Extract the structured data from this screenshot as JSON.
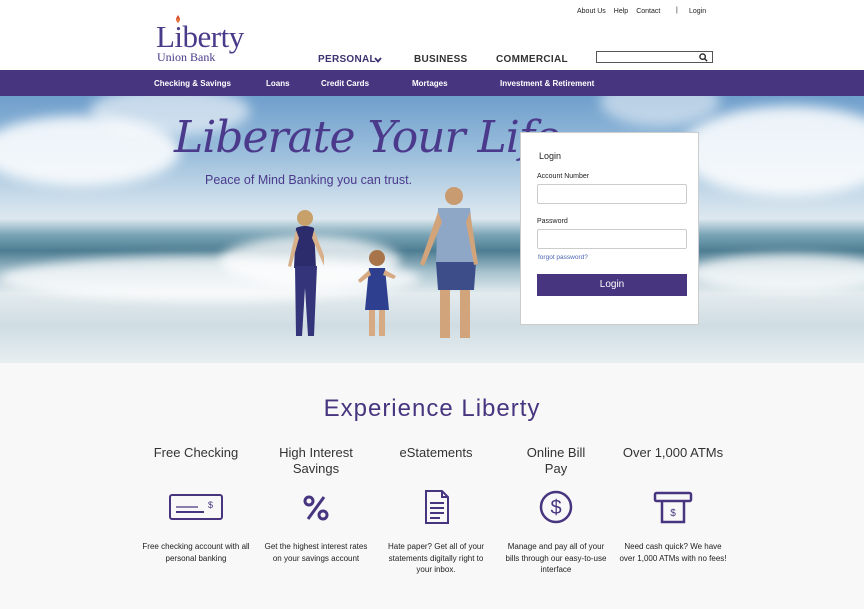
{
  "utility": {
    "about": "About Us",
    "help": "Help",
    "contact": "Contact",
    "separator": "|",
    "login": "Login"
  },
  "logo": {
    "word": "Liberty",
    "sub": "Union Bank"
  },
  "mainnav": {
    "personal": "PERSONAL",
    "business": "BUSINESS",
    "commercial": "COMMERCIAL"
  },
  "search": {
    "placeholder": ""
  },
  "subnav": {
    "items": [
      "Checking & Savings",
      "Loans",
      "Credit Cards",
      "Mortages",
      "Investment & Retirement"
    ]
  },
  "hero": {
    "title": "Liberate Your Life.",
    "subtitle": "Peace of Mind Banking you can trust."
  },
  "login": {
    "title": "Login",
    "account_label": "Account Number",
    "password_label": "Password",
    "forgot": "forgot password?",
    "button": "Login"
  },
  "features": {
    "title": "Experience Liberty",
    "items": [
      {
        "title": "Free Checking",
        "icon": "check-icon",
        "desc": "Free checking account with all personal banking"
      },
      {
        "title": "High Interest Savings",
        "icon": "percent-icon",
        "desc": "Get the highest interest rates on your savings account"
      },
      {
        "title": "eStatements",
        "icon": "document-icon",
        "desc": "Hate paper? Get all of your statements digitally right to your inbox."
      },
      {
        "title": "Online Bill Pay",
        "icon": "dollar-circle-icon",
        "desc": "Manage and pay all of your bills through our easy-to-use interface"
      },
      {
        "title": "Over 1,000 ATMs",
        "icon": "atm-icon",
        "desc": "Need cash quick? We have over 1,000 ATMs with no fees!"
      }
    ]
  },
  "colors": {
    "brand": "#47357f",
    "link": "#4a64b0"
  }
}
